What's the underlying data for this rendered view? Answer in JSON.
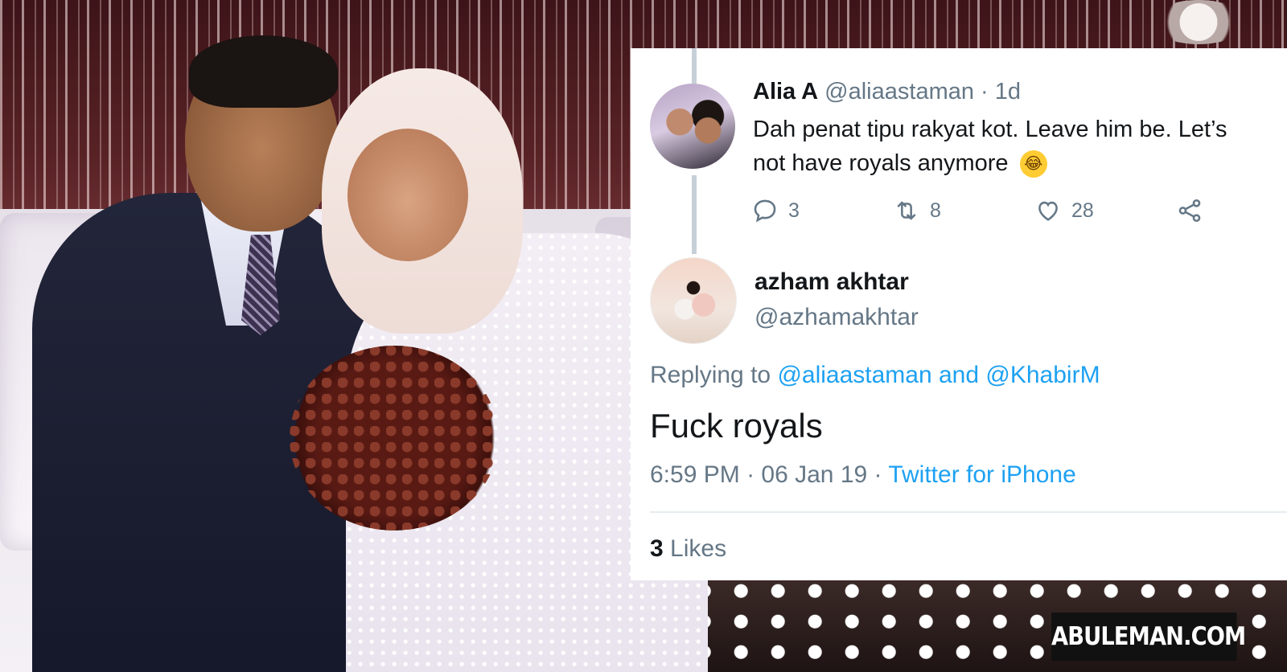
{
  "tweet1": {
    "name": "Alia A",
    "handle": "@aliaastaman",
    "separator": "·",
    "time": "1d",
    "text_line1": "Dah penat tipu rakyat kot. Leave him be. Let’s",
    "text_line2": "not have royals anymore",
    "emoji": "face-with-tears-of-joy-emoji",
    "emoji_glyph": "😂",
    "actions": {
      "reply_count": "3",
      "retweet_count": "8",
      "like_count": "28"
    }
  },
  "tweet2": {
    "name": "azham akhtar",
    "handle": "@azhamakhtar",
    "replying_prefix": "Replying to",
    "replying_to_1": "@aliaastaman",
    "replying_and": "and",
    "replying_to_2": "@KhabirM",
    "text": "Fuck royals",
    "time": "6:59 PM",
    "sep1": "·",
    "date": "06 Jan 19",
    "sep2": "·",
    "source": "Twitter for iPhone",
    "likes_count": "3",
    "likes_label": "Likes"
  },
  "watermark": "ABULEMAN.COM",
  "colors": {
    "link": "#1da1f2",
    "secondary_text": "#657786",
    "primary_text": "#14171a",
    "thread_line": "#c7d0d8",
    "divider": "#e6ecf0"
  },
  "icons": [
    "reply-icon",
    "retweet-icon",
    "like-icon",
    "share-icon"
  ]
}
